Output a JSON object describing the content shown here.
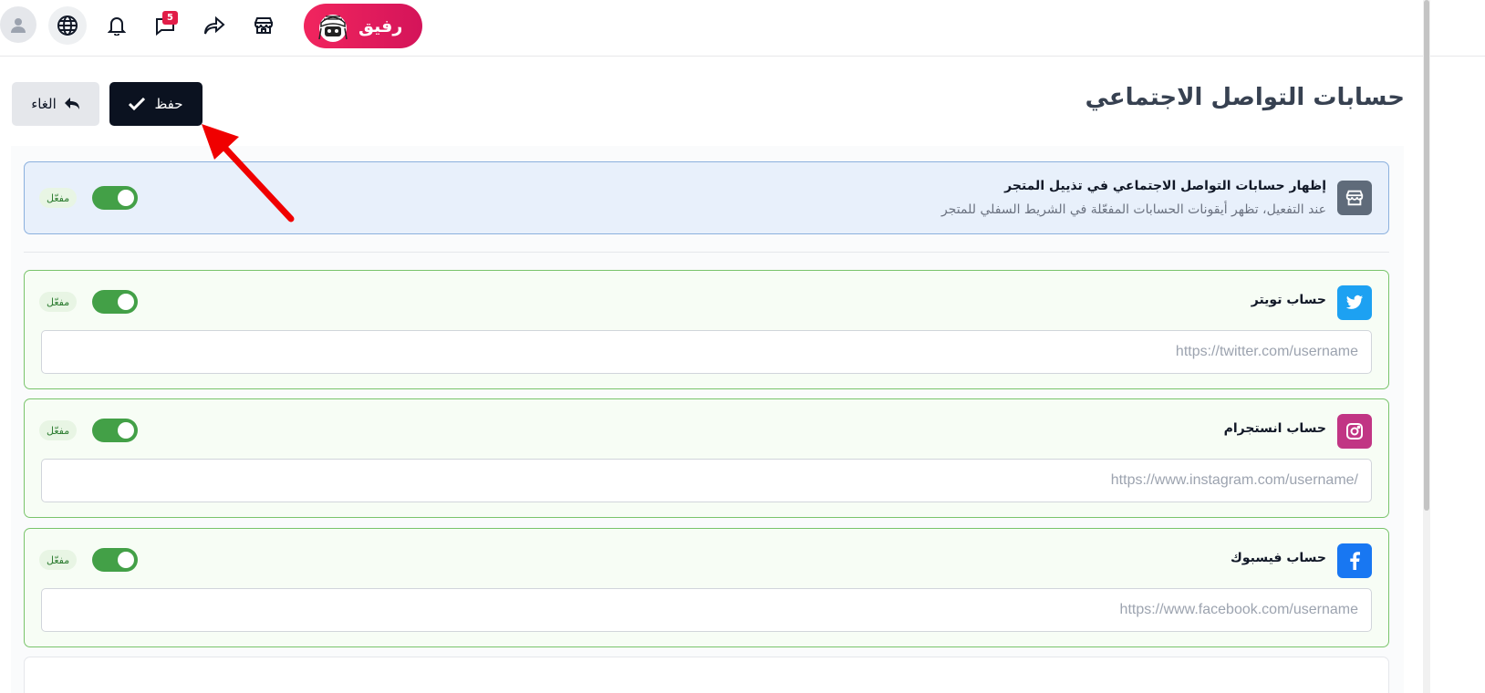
{
  "topbar": {
    "notifications_count": "5",
    "rafiq_label": "رفيق",
    "icons": [
      "user-icon",
      "globe-icon",
      "bell-icon",
      "chat-icon",
      "share-icon",
      "store-icon"
    ]
  },
  "header": {
    "title": "حسابات التواصل الاجتماعي",
    "save_label": "حفظ",
    "cancel_label": "الغاء"
  },
  "main_toggle": {
    "title": "إظهار حسابات التواصل الاجتماعي في تذييل المتجر",
    "description": "عند التفعيل، تظهر أيقونات الحسابات المفعّلة في الشريط السفلي للمتجر",
    "status": "مفعّل",
    "enabled": true
  },
  "accounts": [
    {
      "title": "حساب تويتر",
      "placeholder": "https://twitter.com/username",
      "value": "",
      "status": "مفعّل",
      "enabled": true,
      "icon": "twitter-icon",
      "color": "#1da1f2"
    },
    {
      "title": "حساب انستجرام",
      "placeholder": "https://www.instagram.com/username/",
      "value": "",
      "status": "مفعّل",
      "enabled": true,
      "icon": "instagram-icon",
      "color": "#c13584"
    },
    {
      "title": "حساب فيسبوك",
      "placeholder": "https://www.facebook.com/username",
      "value": "",
      "status": "مفعّل",
      "enabled": true,
      "icon": "facebook-icon",
      "color": "#1877f2"
    }
  ],
  "colors": {
    "save_button": "#0b1220",
    "toggle_on": "#43a047",
    "rafiq_gradient_start": "#f1255e",
    "rafiq_gradient_end": "#d4145a",
    "annotation_arrow": "#f00000"
  }
}
